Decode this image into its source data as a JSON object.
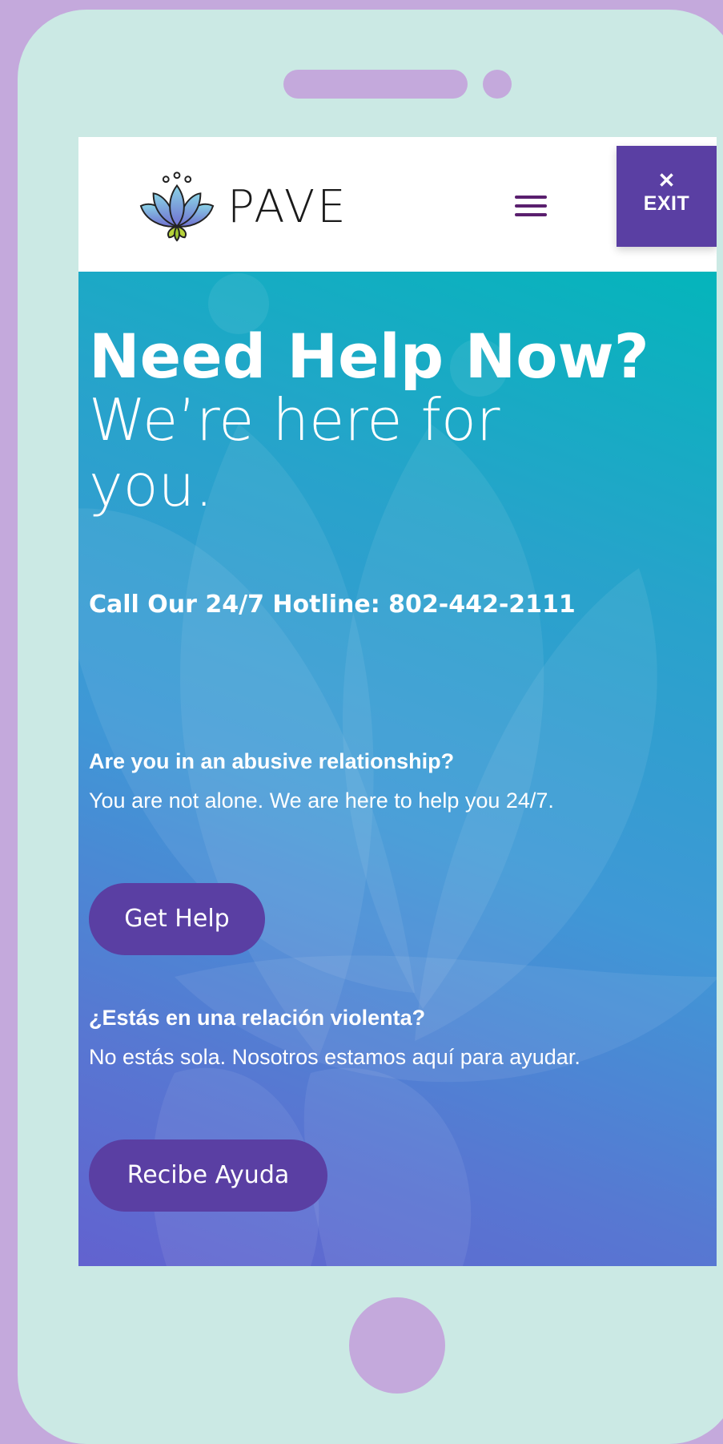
{
  "brand": {
    "name": "PAVE"
  },
  "header": {
    "menu_icon": "hamburger-menu-icon",
    "exit": {
      "icon": "close-icon",
      "label": "EXIT"
    }
  },
  "hero": {
    "headline": "Need Help Now?",
    "subheadline": "We’re here for you.",
    "hotline": "Call Our 24/7 Hotline: 802-442-2111",
    "english": {
      "question": "Are you in an abusive relationship?",
      "answer": "You are not alone. We are here to help you 24/7.",
      "button": "Get Help"
    },
    "spanish": {
      "question": "¿Estás en una relación violenta?",
      "answer": "No estás sola. Nosotros estamos aquí para ayudar.",
      "button": "Recibe Ayuda"
    }
  },
  "colors": {
    "page_background": "#c4a9dc",
    "phone_body": "#cbe9e4",
    "button_purple": "#5a3fa3",
    "menu_icon": "#5a1f6e",
    "hero_gradient_start": "#04b5bb",
    "hero_gradient_end": "#6262cf"
  }
}
